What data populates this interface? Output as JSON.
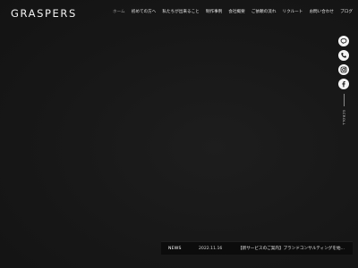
{
  "header": {
    "logo": "GRASPERS",
    "nav": [
      {
        "label": "ホーム",
        "active": true
      },
      {
        "label": "初めての方へ",
        "active": false
      },
      {
        "label": "私たちが出来ること",
        "active": false
      },
      {
        "label": "制作事例",
        "active": false
      },
      {
        "label": "会社概要",
        "active": false
      },
      {
        "label": "ご依頼の流れ",
        "active": false
      },
      {
        "label": "リクルート",
        "active": false
      },
      {
        "label": "お問い合わせ",
        "active": false
      },
      {
        "label": "ブログ",
        "active": false
      }
    ]
  },
  "sns": {
    "icons": [
      "line-icon",
      "phone-icon",
      "instagram-icon",
      "facebook-icon"
    ],
    "scroll_label": "SCROLL"
  },
  "news": {
    "label": "NEWS",
    "date": "2022.11.16",
    "text": "【新サービスのご案内】ブランドコンサルティングを始..."
  },
  "colors": {
    "background": "#161616",
    "text": "#ffffff",
    "icon_fill": "#f4f4f4",
    "news_bar": "#0c0c0c"
  }
}
